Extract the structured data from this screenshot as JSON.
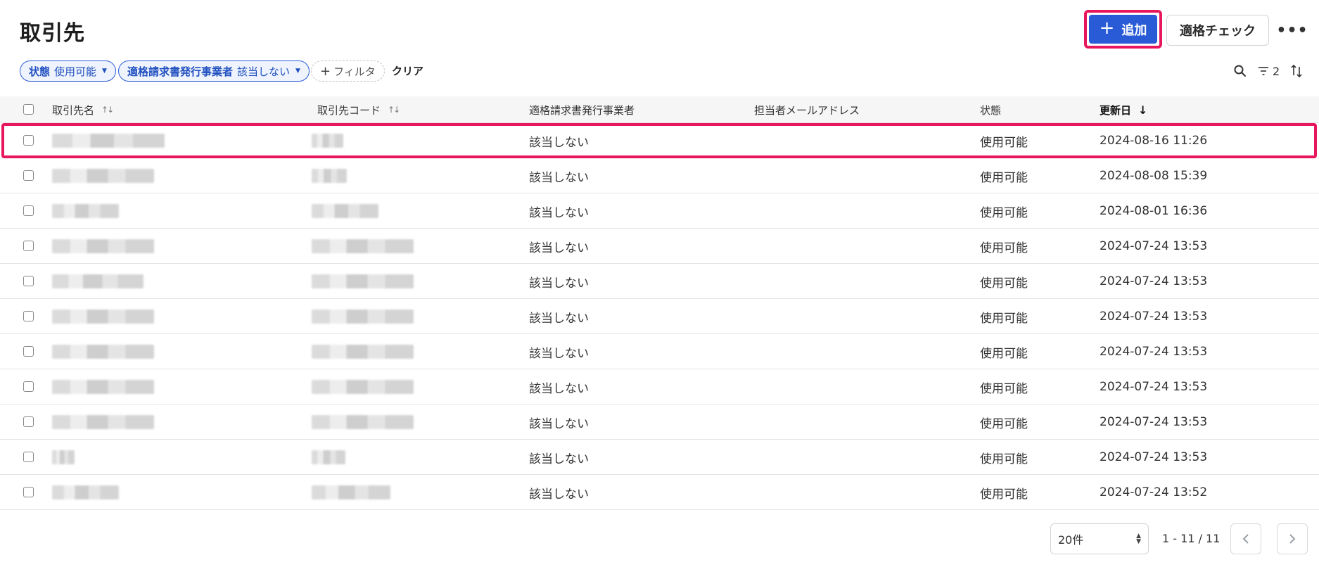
{
  "header": {
    "title": "取引先",
    "add_label": "追加",
    "check_label": "適格チェック",
    "more_label": "•••"
  },
  "filters": {
    "status_key": "状態",
    "status_value": "使用可能",
    "invoice_key": "適格請求書発行事業者",
    "invoice_value": "該当しない",
    "add_filter_label": "フィルタ",
    "clear_label": "クリア",
    "active_count": "2"
  },
  "table": {
    "columns": {
      "name": "取引先名",
      "code": "取引先コード",
      "invoice": "適格請求書発行事業者",
      "email": "担当者メールアドレス",
      "status": "状態",
      "updated": "更新日"
    },
    "rows": [
      {
        "invoice": "該当しない",
        "status": "使用可能",
        "updated": "2024-08-16 11:26"
      },
      {
        "invoice": "該当しない",
        "status": "使用可能",
        "updated": "2024-08-08 15:39"
      },
      {
        "invoice": "該当しない",
        "status": "使用可能",
        "updated": "2024-08-01 16:36"
      },
      {
        "invoice": "該当しない",
        "status": "使用可能",
        "updated": "2024-07-24 13:53"
      },
      {
        "invoice": "該当しない",
        "status": "使用可能",
        "updated": "2024-07-24 13:53"
      },
      {
        "invoice": "該当しない",
        "status": "使用可能",
        "updated": "2024-07-24 13:53"
      },
      {
        "invoice": "該当しない",
        "status": "使用可能",
        "updated": "2024-07-24 13:53"
      },
      {
        "invoice": "該当しない",
        "status": "使用可能",
        "updated": "2024-07-24 13:53"
      },
      {
        "invoice": "該当しない",
        "status": "使用可能",
        "updated": "2024-07-24 13:53"
      },
      {
        "invoice": "該当しない",
        "status": "使用可能",
        "updated": "2024-07-24 13:53"
      },
      {
        "invoice": "該当しない",
        "status": "使用可能",
        "updated": "2024-07-24 13:52"
      }
    ]
  },
  "pagination": {
    "per_page": "20件",
    "range": "1 - 11 / 11"
  },
  "colors": {
    "primary": "#2a5bd7",
    "highlight": "#e8175d"
  }
}
